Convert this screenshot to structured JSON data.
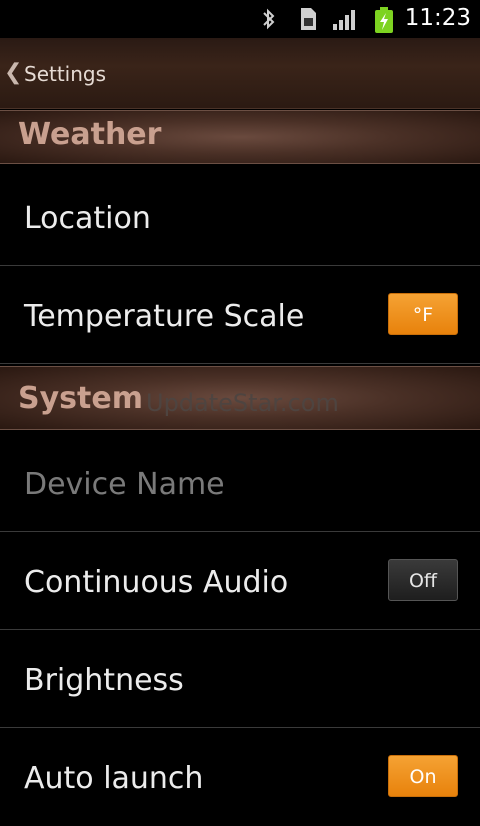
{
  "status_bar": {
    "time": "11:23",
    "icons": [
      "bluetooth-icon",
      "sim-card-icon",
      "signal-icon",
      "battery-charging-icon"
    ]
  },
  "title_bar": {
    "back_label": "Settings"
  },
  "sections": {
    "weather": {
      "title": "Weather",
      "rows": {
        "location": {
          "label": "Location"
        },
        "temperature_scale": {
          "label": "Temperature Scale",
          "value": "°F"
        }
      }
    },
    "system": {
      "title": "System",
      "watermark": "UpdateStar.com",
      "rows": {
        "device_name": {
          "label": "Device Name"
        },
        "continuous_audio": {
          "label": "Continuous Audio",
          "value": "Off"
        },
        "brightness": {
          "label": "Brightness"
        },
        "auto_launch": {
          "label": "Auto launch",
          "value": "On"
        }
      }
    }
  },
  "colors": {
    "accent_orange": "#e8820c",
    "header_text": "#c9a08f",
    "disabled_text": "#7a7a7a",
    "battery_green": "#7dd321"
  }
}
